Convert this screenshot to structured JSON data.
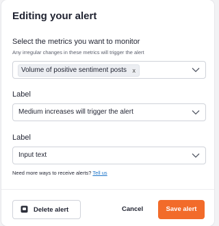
{
  "dialog": {
    "title": "Editing your alert",
    "metrics": {
      "label": "Select the metrics you want to monitor",
      "hint": "Any irregular changes in these metrics will trigger the alert",
      "selected_chip": "Volume of positive sentiment posts",
      "chip_remove": "x"
    },
    "label1": {
      "label": "Label",
      "value": "Medium increases will trigger the alert"
    },
    "label2": {
      "label": "Label",
      "placeholder": "Input text"
    },
    "more_ways": {
      "text": "Need more ways to receive alerts?",
      "link": "Tell us"
    },
    "footer": {
      "delete_label": "Delete alert",
      "cancel_label": "Cancel",
      "save_label": "Save alert"
    }
  },
  "colors": {
    "accent": "#f26b2a",
    "link": "#1a73c9"
  },
  "icons": {
    "delete": "delete-icon",
    "chevron": "chevron-down-icon"
  }
}
